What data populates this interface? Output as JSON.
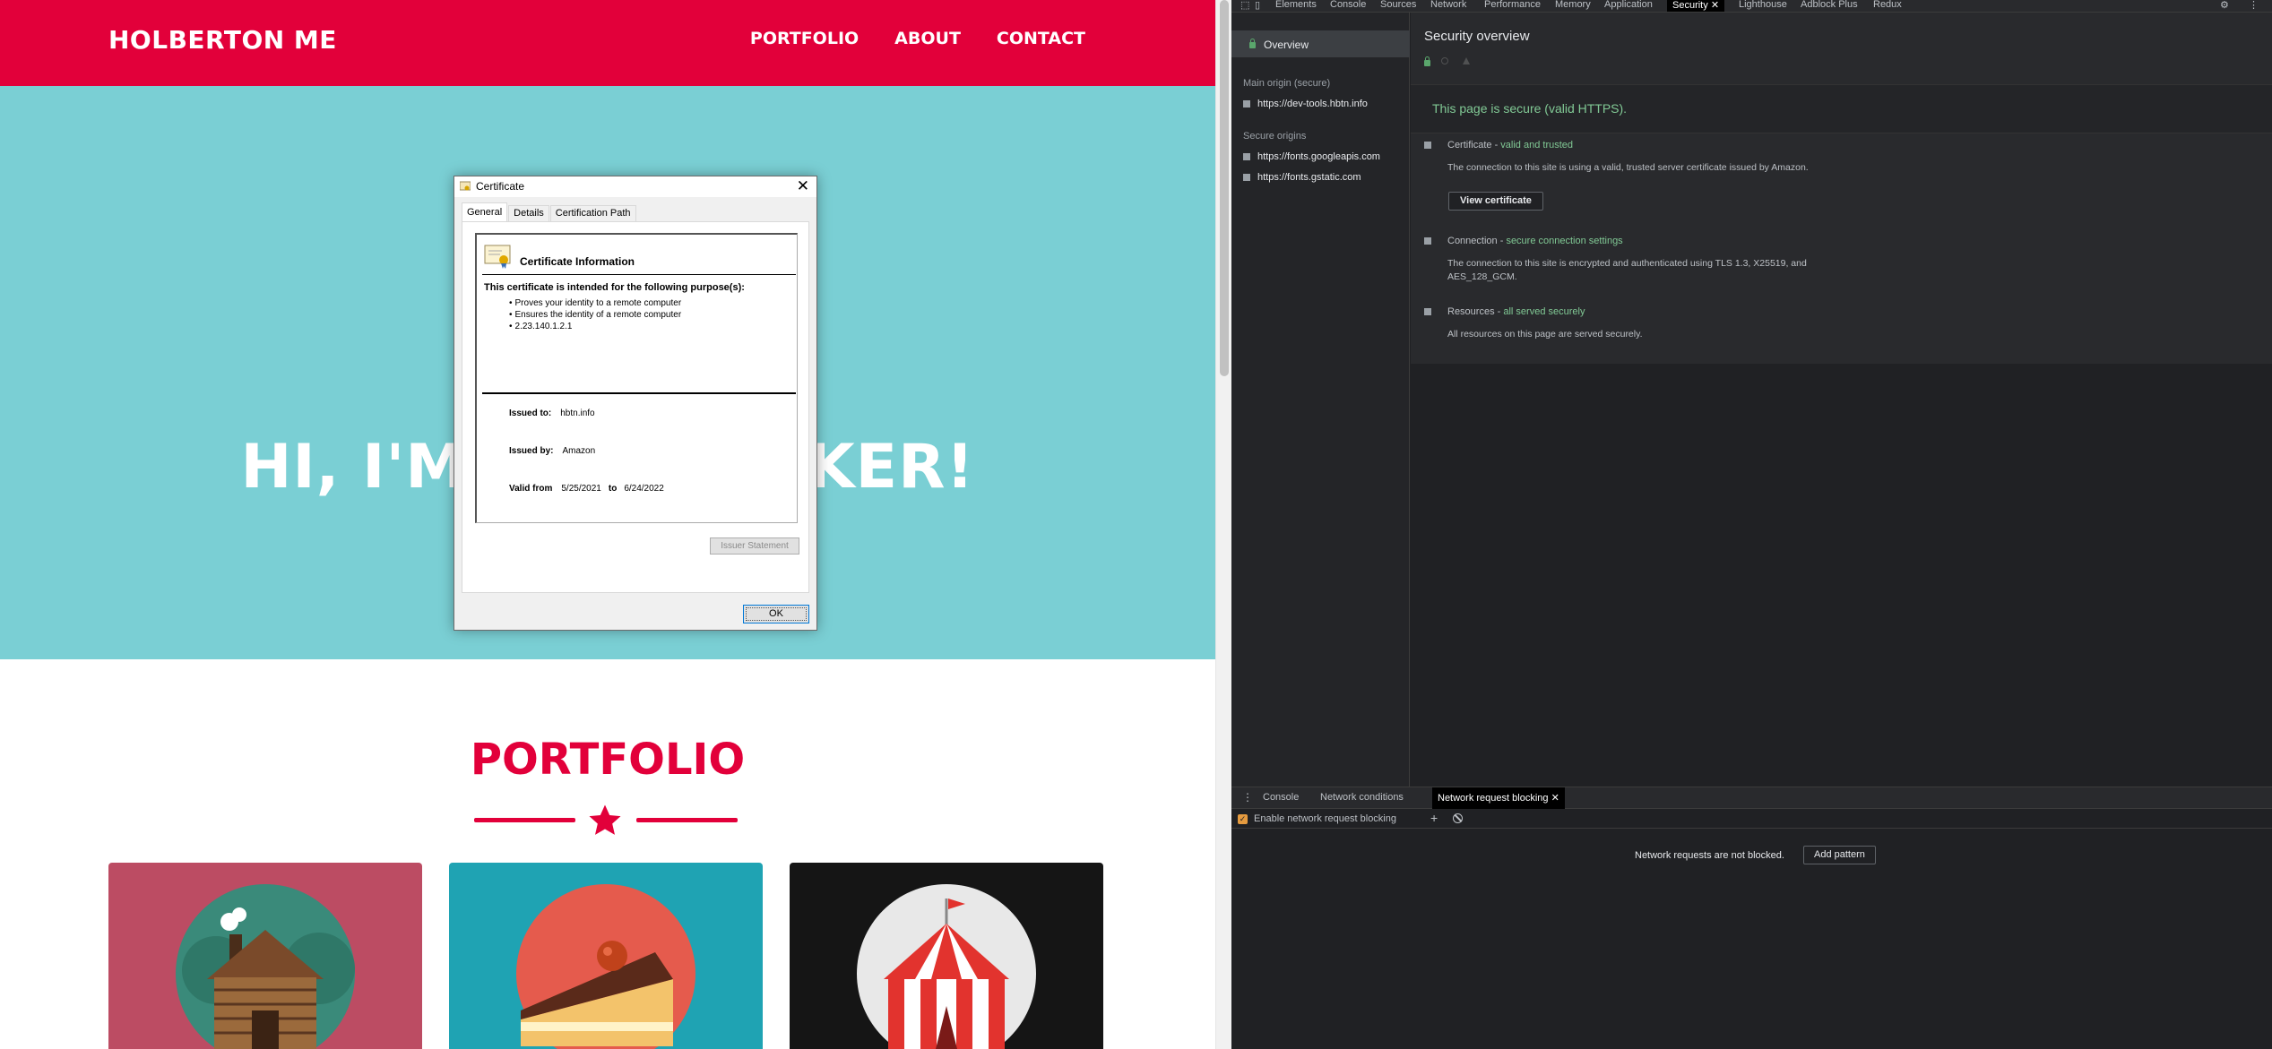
{
  "site": {
    "brand": "HOLBERTON ME",
    "nav": [
      "PORTFOLIO",
      "ABOUT",
      "CONTACT"
    ],
    "hero_left": "HI, I'M",
    "hero_right": "KER!",
    "portfolio_title": "PORTFOLIO",
    "colors": {
      "nav": "#e2003a",
      "hero": "#7acfd4",
      "card1": "#bc4c63",
      "card2": "#1fa3b3",
      "card3": "#151515"
    },
    "cards": [
      "cabin-icon",
      "cake-icon",
      "circus-tent-icon"
    ]
  },
  "dialog": {
    "title": "Certificate",
    "tabs": [
      "General",
      "Details",
      "Certification Path"
    ],
    "heading": "Certificate Information",
    "purpose": "This certificate is intended for the following purpose(s):",
    "bullets": [
      "Proves your identity to a remote computer",
      "Ensures the identity of a remote computer",
      "2.23.140.1.2.1"
    ],
    "issued_to_label": "Issued to:",
    "issued_to": "hbtn.info",
    "issued_by_label": "Issued by:",
    "issued_by": "Amazon",
    "valid_from_label": "Valid from",
    "valid_from": "5/25/2021",
    "to_label": "to",
    "valid_to": "6/24/2022",
    "issuer_btn": "Issuer Statement",
    "ok": "OK"
  },
  "devtools": {
    "tabs": [
      "Elements",
      "Console",
      "Sources",
      "Network",
      "Performance",
      "Memory",
      "Application",
      "Security",
      "Lighthouse",
      "Adblock Plus",
      "Redux"
    ],
    "active_tab": "Security",
    "sidebar": {
      "overview": "Overview",
      "main_origin_head": "Main origin (secure)",
      "main_origin": "https://dev-tools.hbtn.info",
      "secure_head": "Secure origins",
      "secure": [
        "https://fonts.googleapis.com",
        "https://fonts.gstatic.com"
      ]
    },
    "main": {
      "title": "Security overview",
      "summary": "This page is secure (valid HTTPS).",
      "cert_head": "Certificate - ",
      "cert_status": "valid and trusted",
      "cert_desc": "The connection to this site is using a valid, trusted server certificate issued by Amazon.",
      "view_cert": "View certificate",
      "conn_head": "Connection - ",
      "conn_status": "secure connection settings",
      "conn_desc": "The connection to this site is encrypted and authenticated using TLS 1.3, X25519, and AES_128_GCM.",
      "res_head": "Resources - ",
      "res_status": "all served securely",
      "res_desc": "All resources on this page are served securely."
    },
    "drawer": {
      "tabs": [
        "Console",
        "Network conditions",
        "Network request blocking"
      ],
      "enable_label": "Enable network request blocking",
      "empty": "Network requests are not blocked.",
      "add_pattern": "Add pattern"
    }
  }
}
